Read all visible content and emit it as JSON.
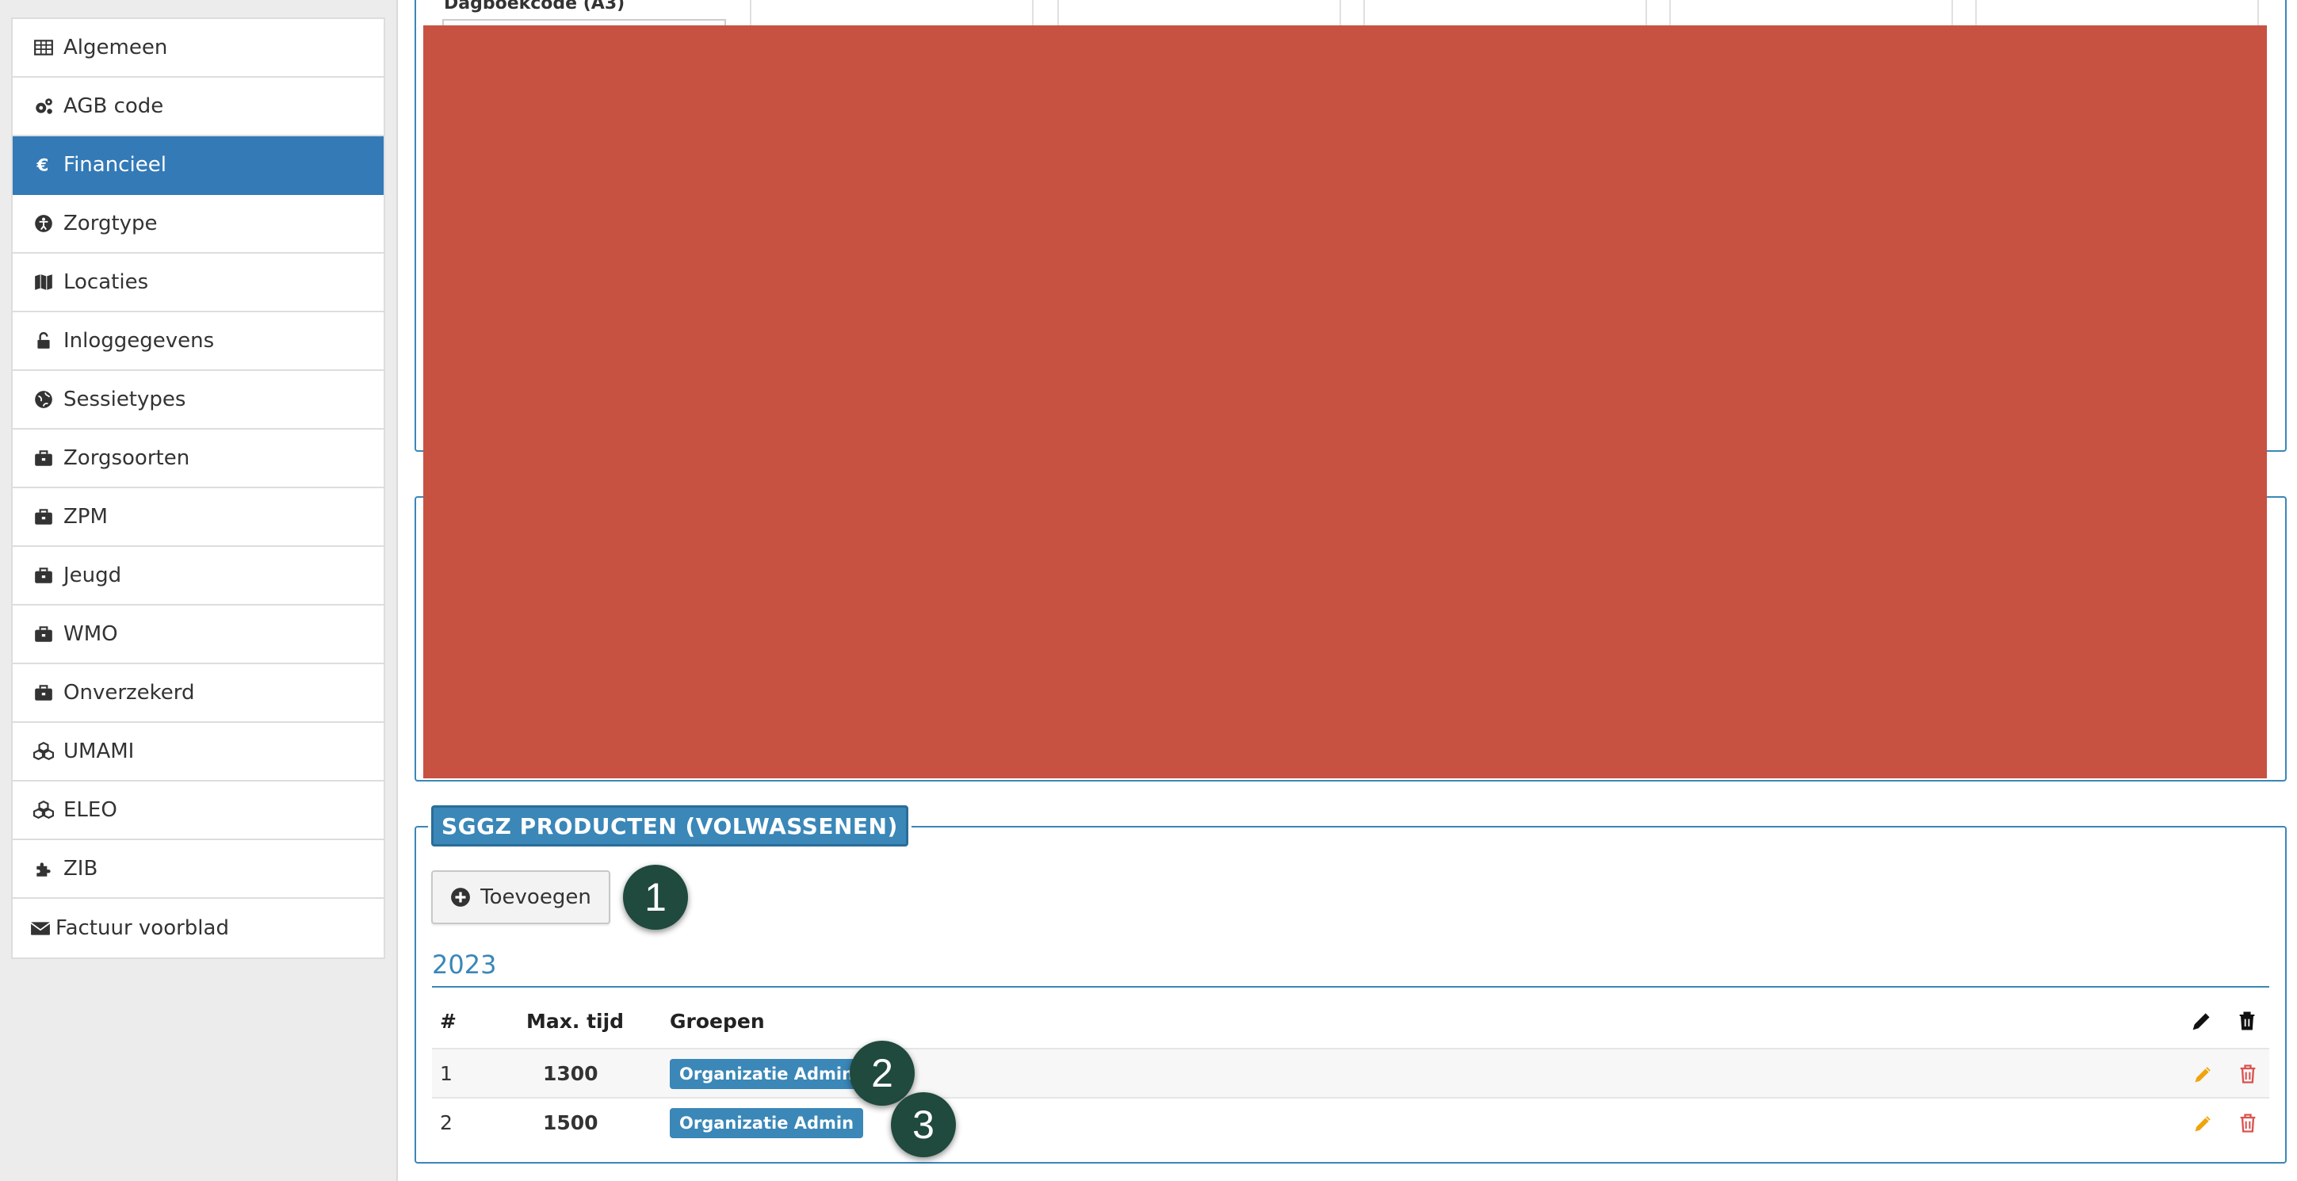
{
  "sidebar": {
    "items": [
      {
        "label": "Algemeen",
        "icon": "table-icon",
        "active": false
      },
      {
        "label": "AGB code",
        "icon": "cogs-icon",
        "active": false
      },
      {
        "label": "Financieel",
        "icon": "euro-icon",
        "active": true
      },
      {
        "label": "Zorgtype",
        "icon": "accessibility-icon",
        "active": false
      },
      {
        "label": "Locaties",
        "icon": "map-icon",
        "active": false
      },
      {
        "label": "Inloggegevens",
        "icon": "unlock-icon",
        "active": false
      },
      {
        "label": "Sessietypes",
        "icon": "globe-icon",
        "active": false
      },
      {
        "label": "Zorgsoorten",
        "icon": "briefcase-icon",
        "active": false
      },
      {
        "label": "ZPM",
        "icon": "briefcase-icon",
        "active": false
      },
      {
        "label": "Jeugd",
        "icon": "briefcase-icon",
        "active": false
      },
      {
        "label": "WMO",
        "icon": "briefcase-icon",
        "active": false
      },
      {
        "label": "Onverzekerd",
        "icon": "briefcase-icon",
        "active": false
      },
      {
        "label": "UMAMI",
        "icon": "cubes-icon",
        "active": false
      },
      {
        "label": "ELEO",
        "icon": "cubes-icon",
        "active": false
      },
      {
        "label": "ZIB",
        "icon": "puzzle-icon",
        "active": false
      },
      {
        "label": "Factuur voorblad",
        "icon": "envelope-icon",
        "active": false
      }
    ]
  },
  "top_section": {
    "field_label": "Dagboekcode (A3)"
  },
  "sggz": {
    "legend": "SGGZ PRODUCTEN (VOLWASSENEN)",
    "add_button": "Toevoegen",
    "year": "2023",
    "columns": {
      "num": "#",
      "max_time": "Max. tijd",
      "groups": "Groepen"
    },
    "rows": [
      {
        "num": "1",
        "max_time": "1300",
        "group": "Organizatie Admin"
      },
      {
        "num": "2",
        "max_time": "1500",
        "group": "Organizatie Admin"
      }
    ]
  },
  "markers": [
    "1",
    "2",
    "3"
  ],
  "colors": {
    "accent": "#337ab7",
    "panel_border": "#3a87b8",
    "redaction": "#c85242",
    "marker": "#1f4a3d",
    "edit": "#f0a30a",
    "delete": "#d9534f"
  }
}
